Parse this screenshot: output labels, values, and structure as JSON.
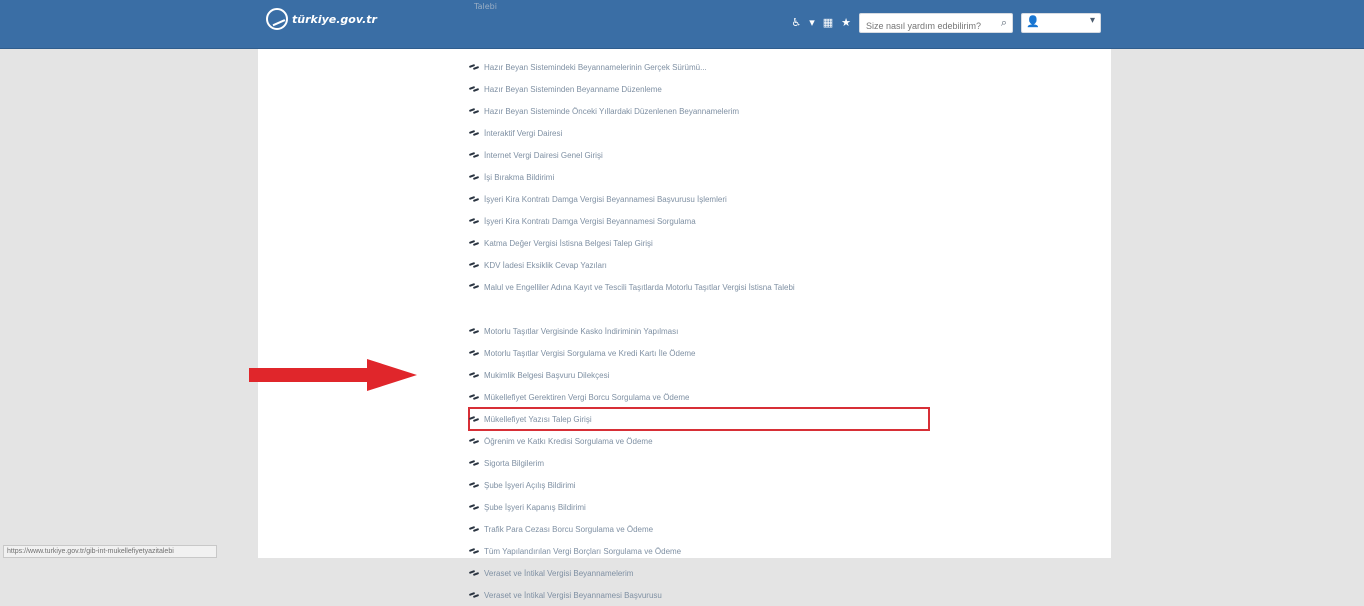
{
  "header": {
    "logo_text": "türkiye.gov.tr",
    "accessibility_icon": "accessibility-icon",
    "dropdown_arrow": "▾",
    "grid_icon": "grid-icon",
    "star_icon": "star-icon",
    "search_placeholder": "Size nasıl yardım edebilirim?",
    "search_icon": "search-icon",
    "user_icon": "user-icon",
    "user_dropdown": "▾"
  },
  "cut_text": "Talebi",
  "menu": [
    "Hazır Beyan Sistemindeki Beyannamelerinin Gerçek Sürümü...",
    "Hazır Beyan Sisteminden Beyanname Düzenleme",
    "Hazır Beyan Sisteminde Önceki Yıllardaki Düzenlenen Beyannamelerim",
    "İnteraktif Vergi Dairesi",
    "İnternet Vergi Dairesi Genel Girişi",
    "İşi Bırakma Bildirimi",
    "İşyeri Kira Kontratı Damga Vergisi Beyannamesi Başvurusu İşlemleri",
    "İşyeri Kira Kontratı Damga Vergisi Beyannamesi Sorgulama",
    "Katma Değer Vergisi İstisna Belgesi Talep Girişi",
    "KDV İadesi Eksiklik Cevap Yazıları",
    "Malul ve Engelliler Adına Kayıt ve Tescili Taşıtlarda Motorlu Taşıtlar Vergisi İstisna Talebi",
    "Motorlu Taşıtlar Vergisinde Kasko İndiriminin Yapılması",
    "Motorlu Taşıtlar Vergisi Sorgulama ve Kredi Kartı İle Ödeme",
    "Mukimlik Belgesi Başvuru Dilekçesi",
    "Mükellefiyet Gerektiren Vergi Borcu Sorgulama ve Ödeme",
    "Mükellefiyet Yazısı Talep Girişi",
    "Öğrenim ve Katkı Kredisi Sorgulama ve Ödeme",
    "Sigorta Bilgilerim",
    "Şube İşyeri Açılış Bildirimi",
    "Şube İşyeri Kapanış Bildirimi",
    "Trafik Para Cezası Borcu Sorgulama ve Ödeme",
    "Tüm Yapılandırılan Vergi Borçları Sorgulama ve Ödeme",
    "Veraset ve İntikal Vergisi Beyannamelerim",
    "Veraset ve İntikal Vergisi Beyannamesi Başvurusu"
  ],
  "status_url": "https://www.turkiye.gov.tr/gib-int-mukellefiyetyazitalebi",
  "colors": {
    "header": "#3a6ea5",
    "highlight": "#d72f36",
    "arrow": "#e0262b"
  }
}
